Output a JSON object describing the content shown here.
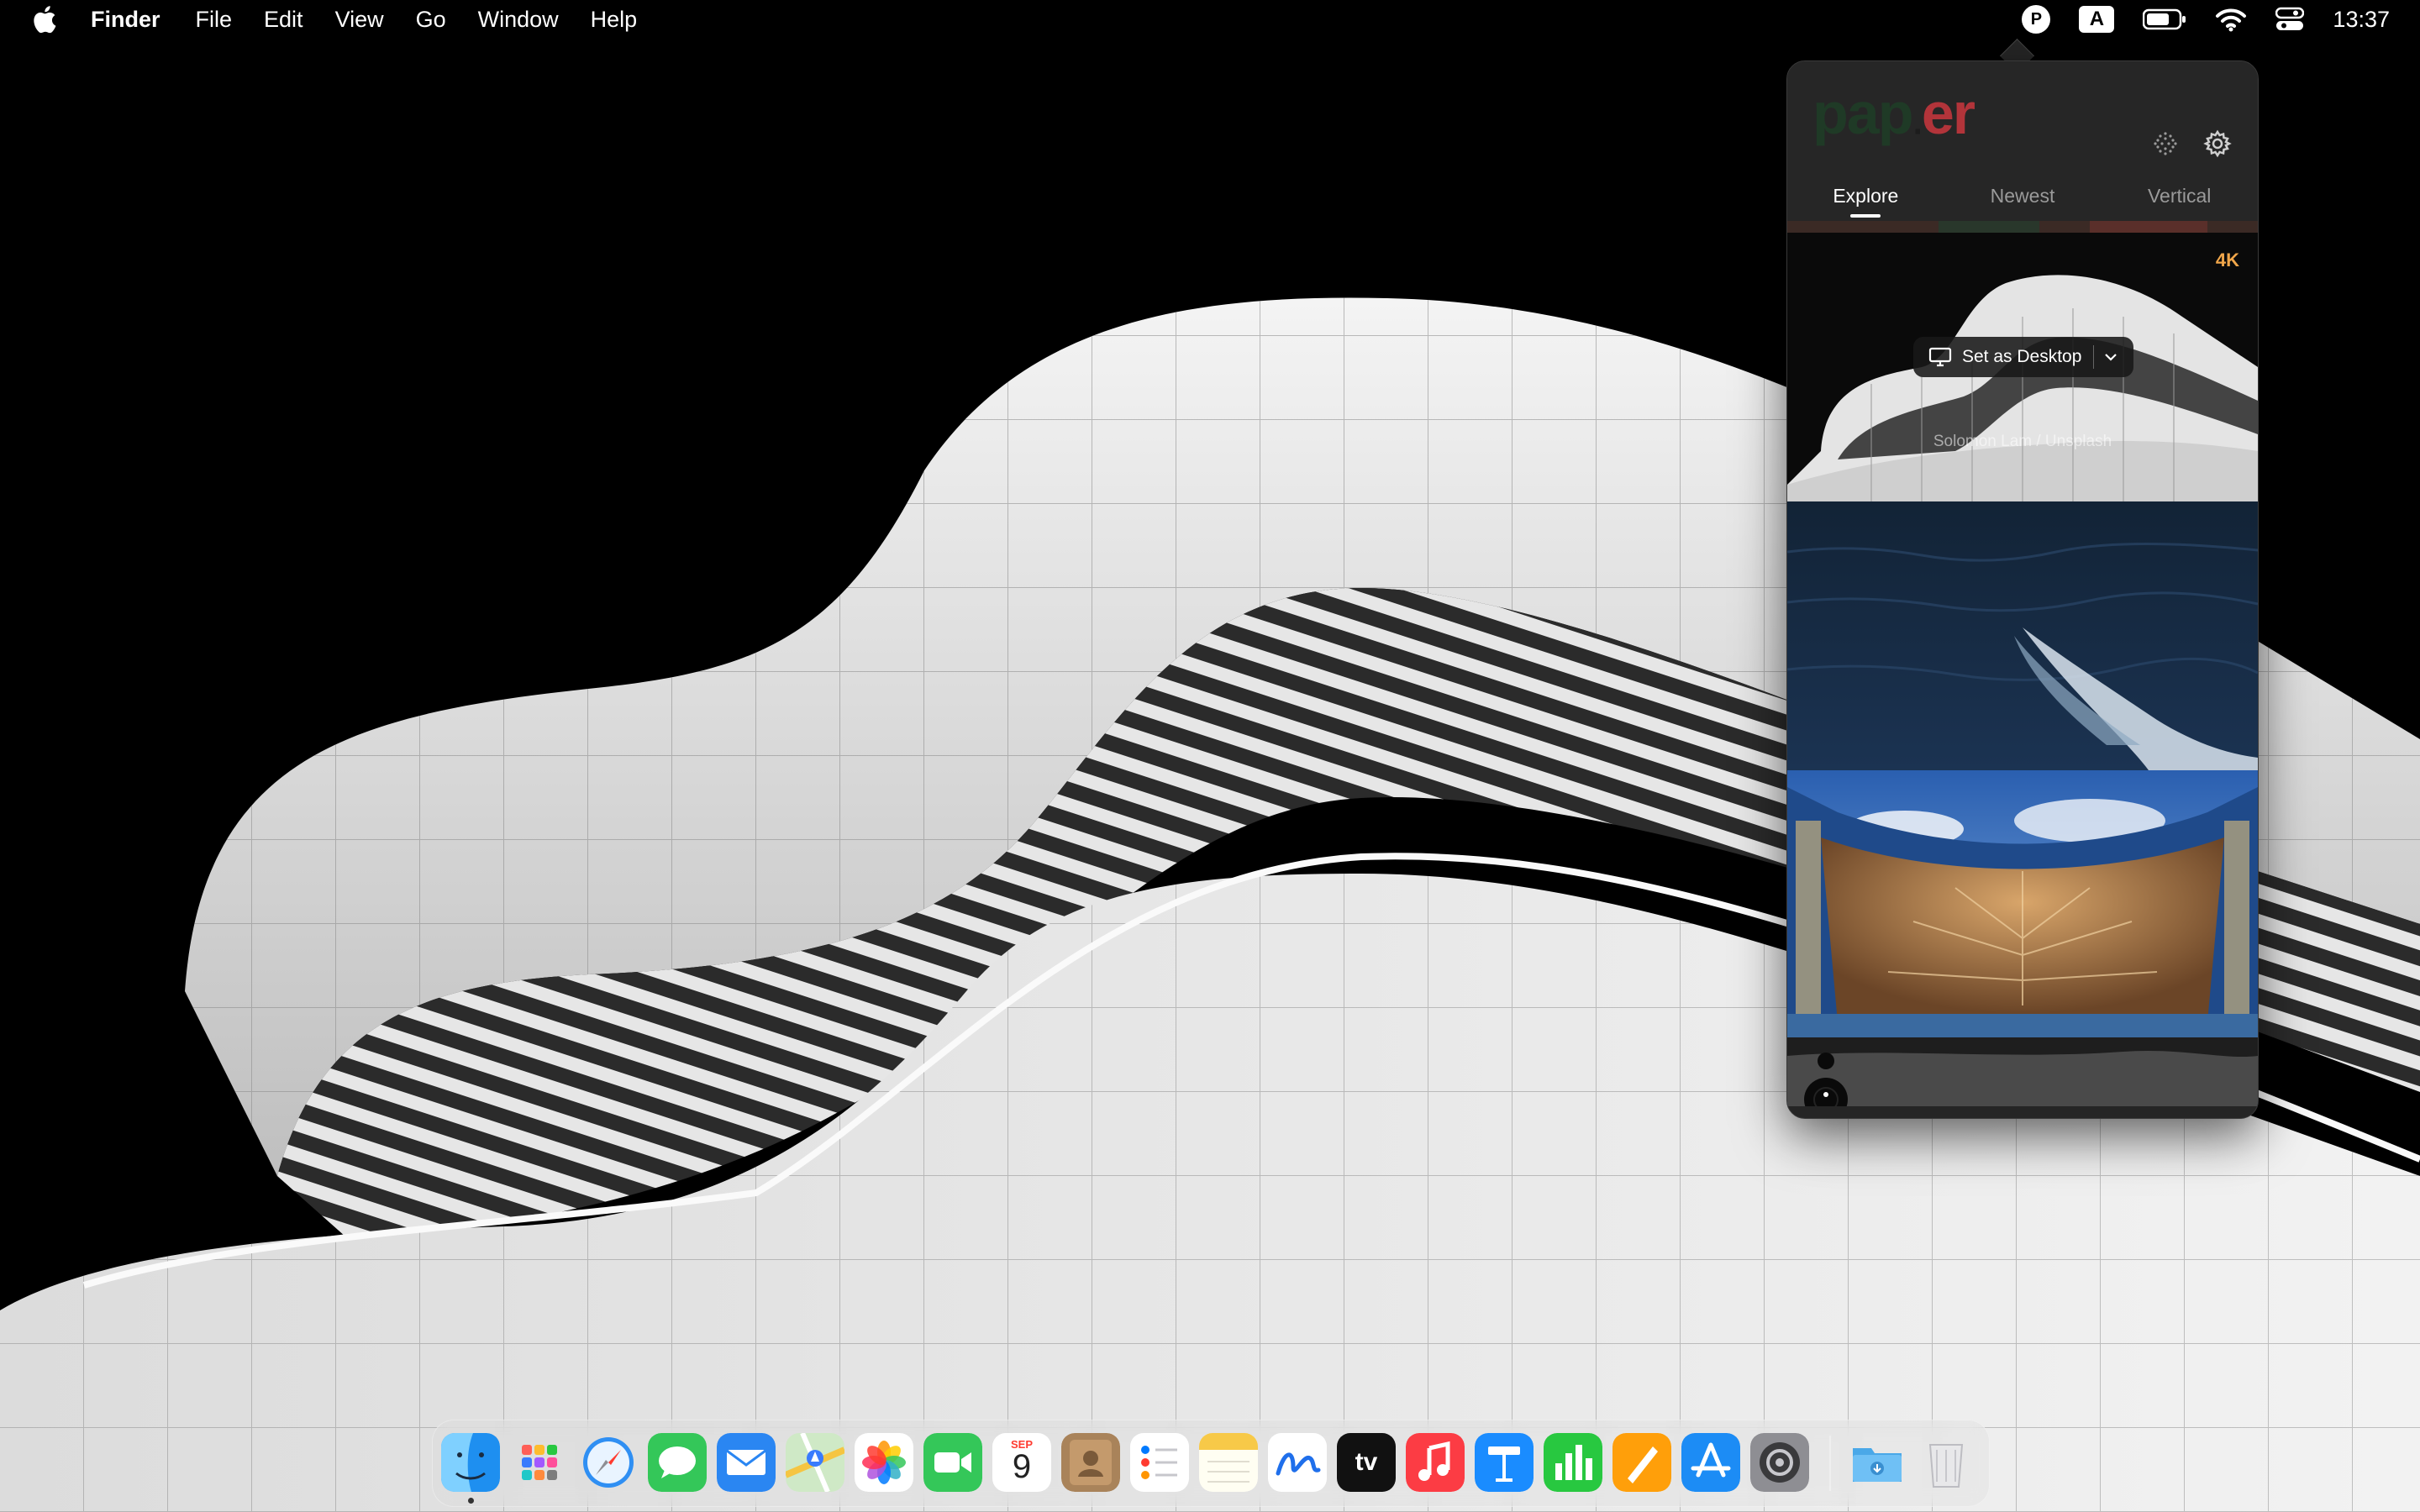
{
  "menubar": {
    "app_name": "Finder",
    "menus": [
      "File",
      "Edit",
      "View",
      "Go",
      "Window",
      "Help"
    ],
    "status_p": "P",
    "status_a": "A",
    "clock": "13:37"
  },
  "paper_app": {
    "logo_part1": "pap",
    "logo_dot": "․",
    "logo_part2": "er",
    "tabs": [
      {
        "label": "Explore",
        "active": true
      },
      {
        "label": "Newest",
        "active": false
      },
      {
        "label": "Vertical",
        "active": false
      }
    ],
    "wallpapers": [
      {
        "badge": "4K",
        "set_label": "Set as Desktop",
        "credit": "Solomon Lam / Unsplash"
      },
      {},
      {},
      {}
    ]
  },
  "dock": {
    "apps": [
      "Finder",
      "Launchpad",
      "Safari",
      "Messages",
      "Mail",
      "Maps",
      "Photos",
      "FaceTime",
      "Calendar",
      "Contacts",
      "Reminders",
      "Notes",
      "Freeform",
      "TV",
      "Music",
      "Keynote",
      "Numbers",
      "Pages",
      "App Store",
      "System Settings",
      "Downloads",
      "Trash"
    ],
    "calendar_month": "SEP",
    "calendar_day": "9",
    "tv_label": "tv"
  }
}
